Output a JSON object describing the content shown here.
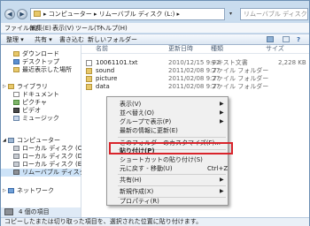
{
  "address": {
    "breadcrumb": "▸ コンピューター ▸ リムーバブル ディスク (L:) ▸",
    "search_placeholder": "リムーバブル ディスク (L:)の検索"
  },
  "menubar": {
    "items": [
      "ファイル(F)",
      "編集(E)",
      "表示(V)",
      "ツール(T)",
      "ヘルプ(H)"
    ]
  },
  "toolbar": {
    "organize": "整理 ▾",
    "share": "共有 ▾",
    "burn": "書き込む",
    "new_folder": "新しいフォルダー"
  },
  "nav": {
    "items": [
      {
        "label": "ダウンロード",
        "icon": "download-folder-icon"
      },
      {
        "label": "デスクトップ",
        "icon": "desktop-icon"
      },
      {
        "label": "最近表示した場所",
        "icon": "recent-places-icon"
      },
      {
        "label": "ライブラリ",
        "icon": "library-icon"
      },
      {
        "label": "ドキュメント",
        "icon": "documents-icon"
      },
      {
        "label": "ピクチャ",
        "icon": "pictures-icon"
      },
      {
        "label": "ビデオ",
        "icon": "videos-icon"
      },
      {
        "label": "ミュージック",
        "icon": "music-icon"
      },
      {
        "label": "コンピューター",
        "icon": "computer-icon"
      },
      {
        "label": "ローカル ディスク (C:)",
        "icon": "drive-icon"
      },
      {
        "label": "ローカル ディスク (D:)",
        "icon": "drive-icon"
      },
      {
        "label": "ローカル ディスク (E:)",
        "icon": "drive-icon"
      },
      {
        "label": "リムーバブル ディスク (L:)",
        "icon": "usb-drive-icon"
      },
      {
        "label": "ネットワーク",
        "icon": "network-icon"
      }
    ]
  },
  "list": {
    "headers": {
      "name": "名前",
      "modified": "更新日時",
      "type": "種類",
      "size": "サイズ"
    },
    "rows": [
      {
        "name": "10061101.txt",
        "modified": "2010/12/15 9:02",
        "type": "テキスト文書",
        "size": "2,228 KB",
        "icon": "text-file-icon"
      },
      {
        "name": "sound",
        "modified": "2011/02/08 9:27",
        "type": "ファイル フォルダー",
        "size": "",
        "icon": "folder-icon"
      },
      {
        "name": "picture",
        "modified": "2011/02/08 9:27",
        "type": "ファイル フォルダー",
        "size": "",
        "icon": "folder-icon"
      },
      {
        "name": "data",
        "modified": "2011/02/08 9:27",
        "type": "ファイル フォルダー",
        "size": "",
        "icon": "folder-icon"
      }
    ]
  },
  "context_menu": {
    "items": [
      {
        "label": "表示(V)",
        "submenu": true
      },
      {
        "label": "並べ替え(O)",
        "submenu": true
      },
      {
        "label": "グループで表示(P)",
        "submenu": true
      },
      {
        "label": "最新の情報に更新(E)",
        "submenu": false
      },
      {
        "label": "このフォルダーのカスタマイズ(F)...",
        "submenu": false
      },
      {
        "label": "貼り付け(P)",
        "submenu": false,
        "highlighted": true
      },
      {
        "label": "ショートカットの貼り付け(S)",
        "submenu": false
      },
      {
        "label": "元に戻す - 移動(U)",
        "shortcut": "Ctrl+Z",
        "submenu": false
      },
      {
        "label": "共有(H)",
        "submenu": true
      },
      {
        "label": "新規作成(X)",
        "submenu": true
      },
      {
        "label": "プロパティ(R)",
        "submenu": false
      }
    ]
  },
  "details_pane": {
    "count": "4 個の項目"
  },
  "status": {
    "text": "コピーしたまたは切り取った項目を、選択された位置に貼り付けます。"
  },
  "colors": {
    "highlight_border": "#d9242b",
    "window_frame": "#c9dcee",
    "folder": "#e8c86a"
  }
}
